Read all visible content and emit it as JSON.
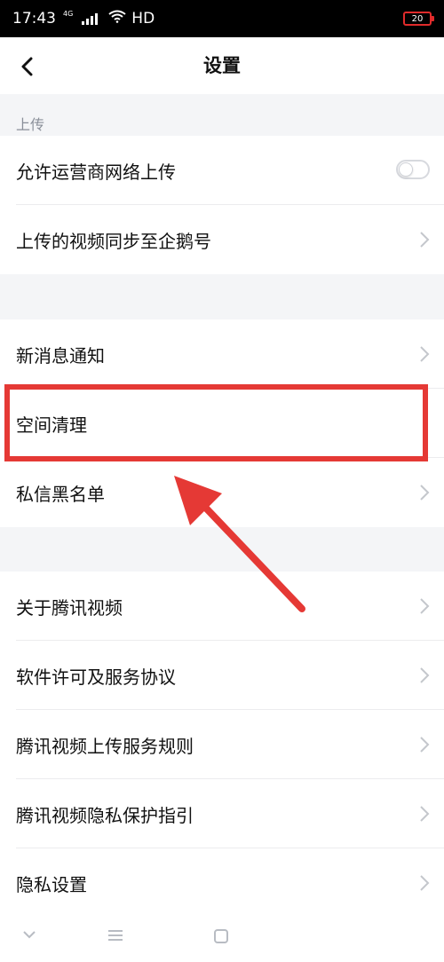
{
  "status_bar": {
    "time": "17:43",
    "network_gen": "4G",
    "network_type": "HD",
    "battery_level": "20",
    "wifi_icon": "wifi-icon",
    "signal_icon": "signal-icon"
  },
  "header": {
    "title": "设置",
    "back_icon": "chevron-left-icon"
  },
  "sections": [
    {
      "header": "上传",
      "items": [
        {
          "label": "允许运营商网络上传",
          "control": "toggle",
          "toggle_on": false
        },
        {
          "label": "上传的视频同步至企鹅号",
          "control": "chevron"
        }
      ]
    },
    {
      "header": "",
      "items": [
        {
          "label": "新消息通知",
          "control": "chevron"
        },
        {
          "label": "空间清理",
          "control": "none",
          "highlighted": true
        },
        {
          "label": "私信黑名单",
          "control": "chevron"
        }
      ]
    },
    {
      "header": "",
      "items": [
        {
          "label": "关于腾讯视频",
          "control": "chevron"
        },
        {
          "label": "软件许可及服务协议",
          "control": "chevron"
        },
        {
          "label": "腾讯视频上传服务规则",
          "control": "chevron"
        },
        {
          "label": "腾讯视频隐私保护指引",
          "control": "chevron"
        },
        {
          "label": "隐私设置",
          "control": "chevron"
        }
      ]
    }
  ],
  "annotation": {
    "color": "#e53935"
  },
  "colors": {
    "background": "#f4f5f7",
    "row": "#ffffff",
    "text": "#111111",
    "section_header": "#8a8f99"
  },
  "bottom_nav": {
    "icons": [
      "chevron-down-icon",
      "menu-icon",
      "square-icon"
    ]
  }
}
